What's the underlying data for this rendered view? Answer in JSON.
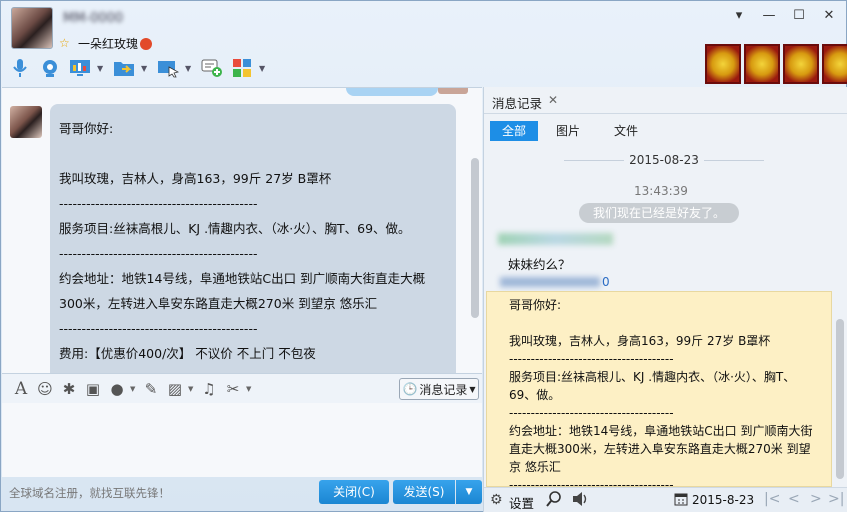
{
  "header": {
    "contact_name": "MM-0000",
    "signature": "一朵红玫瑰"
  },
  "window_controls": [
    "▾",
    "—",
    "☐",
    "✕"
  ],
  "chat": {
    "message_lines": [
      "哥哥你好:",
      "",
      "我叫玫瑰，吉林人，身高163，99斤 27岁 B罩杯",
      "--------------------------------------------",
      "服务项目:丝袜高根儿、KJ .情趣内衣、（冰·火）、胸T、69、做。",
      "--------------------------------------------",
      "约会地址：地铁14号线，阜通地铁站C出口 到广顺南大街直走大概300米，左转进入阜安东路直走大概270米  到望京 悠乐汇",
      "--------------------------------------------",
      "费用:【优惠价400/次】 不议价 不上门 不包夜"
    ]
  },
  "input": {
    "history_button": "消息记录",
    "footer_tip": "全球域名注册，就找互联先锋！",
    "close_button": "关闭(C)",
    "send_button": "发送(S)"
  },
  "history": {
    "tab": "消息记录",
    "filters": [
      "全部",
      "图片",
      "文件"
    ],
    "date": "2015-08-23",
    "time": "13:43:39",
    "system_message": "我们现在已经是好友了。",
    "message1": "妹妹约么？",
    "message2_suffix": "0",
    "message2_lines": [
      "哥哥你好:",
      "",
      "我叫玫瑰，吉林人，身高163，99斤 27岁 B罩杯",
      "--------------------------------------",
      "服务项目:丝袜高根儿、KJ .情趣内衣、（冰·火）、胸T、69、做。",
      "--------------------------------------",
      "约会地址：地铁14号线，阜通地铁站C出口 到广顺南大街直走大概300米，左转进入阜安东路直走大概270米 到望京 悠乐汇",
      "--------------------------------------"
    ],
    "settings": "设置",
    "footer_date": "2015-8-23"
  }
}
